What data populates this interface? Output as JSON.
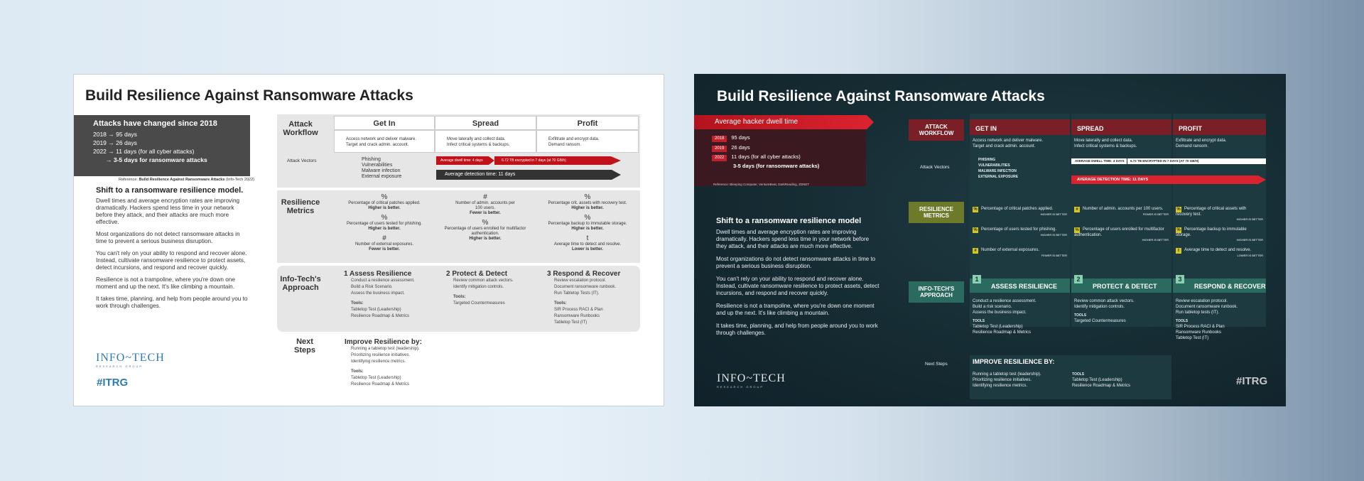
{
  "title": "Build Resilience Against Ransomware Attacks",
  "light": {
    "box_title": "Attacks have changed since 2018",
    "box_lines": [
      "2018 → 95 days",
      "2019 → 26 days",
      "2022 → 11 days (for all cyber attacks)"
    ],
    "box_strong": "→ 3-5 days for ransomware attacks",
    "reference_label": "Reference:",
    "reference_title": "Build Resilience Against Ransomware Attacks",
    "reference_source": "(Info-Tech 2022)",
    "body_heading": "Shift to a ransomware resilience model.",
    "paragraphs": [
      "Dwell times and average encryption rates are improving dramatically. Hackers spend less time in your network before they attack, and their attacks are much more effective.",
      "Most organizations do not detect ransomware attacks in time to prevent a serious business disruption.",
      "You can't rely on your ability to respond and recover alone. Instead, cultivate ransomware resilience to protect assets, detect incursions, and respond and recover quickly.",
      "Resilience is not a trampoline, where you're down one moment and up the next. It's like climbing a mountain.",
      "It takes time, planning, and help from people around you to work through challenges."
    ],
    "row_attack": "Attack Workflow",
    "row_vectors": "Attack Vectors",
    "row_metrics": "Resilience Metrics",
    "row_approach": "Info-Tech's Approach",
    "row_next": "Next Steps",
    "col_get_in": "Get In",
    "col_spread": "Spread",
    "col_profit": "Profit",
    "getin_items": [
      "Access network and deliver malware.",
      "Target and crack admin. account."
    ],
    "spread_items": [
      "Move laterally and collect data.",
      "Infect critical systems & backups."
    ],
    "profit_items": [
      "Exfiltrate and encrypt data.",
      "Demand ransom."
    ],
    "vectors": [
      "Phishing",
      "Vulnerabilities",
      "Malware infection",
      "External exposure"
    ],
    "dwell_bar": "Average dwell time: 4 days",
    "encrypt_bar": "6.72 TB encrypted in 7 days (at 70 GB/h)",
    "detection_bar": "Average detection time: 11 days",
    "m_pct": "%",
    "m_hash": "#",
    "m_t": "t",
    "m1": "Percentage of critical patches applied.",
    "m1b": "Higher is better.",
    "m2": "Percentage of users tested for phishing.",
    "m2b": "Higher is better.",
    "m3": "Number of external exposures.",
    "m3b": "Fewer is better.",
    "m4": "Number of admin. accounts per 100 users.",
    "m4b": "Fewer is better.",
    "m5": "Percentage of users enrolled for multifactor authentication.",
    "m5b": "Higher is better.",
    "m6": "Percentage crit. assets with recovery test.",
    "m6b": "Higher is better.",
    "m7": "Percentage backup to immutable storage.",
    "m7b": "Higher is better.",
    "m8": "Average time to detect and resolve.",
    "m8b": "Lower is better.",
    "s1_title": "1  Assess Resilience",
    "s1_items": [
      "Conduct a resilience assessment.",
      "Build a Risk Scenario.",
      "Assess the business impact."
    ],
    "s1_tools": "Tools:",
    "s1_tool1": "Tabletop Test (Leadership)",
    "s1_tool2": "Resilience Roadmap & Metrics",
    "s2_title": "2  Protect & Detect",
    "s2_items": [
      "Review common attack vectors.",
      "Identify mitigation controls."
    ],
    "s2_tools": "Tools:",
    "s2_tool1": "Targeted Countermeasures",
    "s3_title": "3  Respond & Recover",
    "s3_items": [
      "Review escalation protocol.",
      "Document ransomware runbook.",
      "Run Tabletop Tests (IT)."
    ],
    "s3_tools": "Tools:",
    "s3_tool1": "SIR Process RACI & Plan",
    "s3_tool2": "Ransomware Runbooks",
    "s3_tool3": "Tabletop Test (IT)",
    "next_title": "Improve Resilience by:",
    "next_items": [
      "Running a tabletop test (leadership).",
      "Prioritizing resilience initiatives.",
      "Identifying resilience metrics."
    ],
    "next_tools": "Tools:",
    "next_tool1": "Tabletop Test (Leadership)",
    "next_tool2": "Resilience Roadmap & Metrics",
    "logo_main": "INFO~TECH",
    "logo_sub": "RESEARCH GROUP",
    "logo_itrg": "#ITRG"
  },
  "dark": {
    "banner": "Average hacker dwell time",
    "years": [
      {
        "year": "2018",
        "text": "95 days"
      },
      {
        "year": "2019",
        "text": "26 days"
      },
      {
        "year": "2022",
        "text": "11 days (for all cyber attacks)"
      }
    ],
    "strong": "3-5 days (for ransomware attacks)",
    "reference": "Reference: Bleeping Computer, VentureBeat, DarkReading, ZDNET",
    "body_heading": "Shift to a ransomware resilience model",
    "paragraphs": [
      "Dwell times and average encryption rates are improving dramatically. Hackers spend less time in your network before they attack, and their attacks are much more effective.",
      "Most organizations do not detect ransomware attacks in time to prevent a serious business disruption.",
      "You can't rely on your ability to respond and recover alone. Instead, cultivate ransomware resilience to protect assets, detect incursions, and respond and recover quickly.",
      "Resilience is not a trampoline, where you're down one moment and up the next. It's like climbing a mountain.",
      "It takes time, planning, and help from people around you to work through challenges."
    ],
    "row_attack": "ATTACK WORKFLOW",
    "row_vectors": "Attack Vectors",
    "row_metrics": "RESILIENCE METRICS",
    "row_approach": "INFO-TECH'S APPROACH",
    "row_next": "Next Steps",
    "col_get_in": "GET IN",
    "col_spread": "SPREAD",
    "col_profit": "PROFIT",
    "getin_items": [
      "Access network and deliver malware.",
      "Target and crack admin. account."
    ],
    "spread_items": [
      "Move laterally and collect data.",
      "Infect critical systems & backups."
    ],
    "profit_items": [
      "Exfiltrate and encrypt data.",
      "Demand ransom."
    ],
    "vectors": [
      "PHISHING",
      "VULNERABILITIES",
      "MALWARE INFECTION",
      "EXTERNAL EXPOSURE"
    ],
    "dwell_bar": "AVERAGE DWELL TIME: 4 DAYS",
    "encrypt_bar": "6.72 TB ENCRYPTED IN 7 DAYS (AT 70 GB/H)",
    "detection_bar": "AVERAGE DETECTION TIME: 11 DAYS",
    "m_pct": "%",
    "m_hash": "#",
    "m_t": "t",
    "m1": "Percentage of critical patches applied.",
    "m1b": "HIGHER IS BETTER",
    "m2": "Percentage of users tested for phishing.",
    "m2b": "HIGHER IS BETTER",
    "m3": "Number of external exposures.",
    "m3b": "FEWER IS BETTER",
    "m4": "Number of admin. accounts per 100 users.",
    "m4b": "FEWER IS BETTER",
    "m5": "Percentage of users enrolled for multifactor authentication.",
    "m5b": "HIGHER IS BETTER",
    "m6": "Percentage of critical assets with recovery test.",
    "m6b": "HIGHER IS BETTER",
    "m7": "Percentage backup to immutable storage.",
    "m7b": "HIGHER IS BETTER",
    "m8": "Average time to detect and resolve.",
    "m8b": "LOWER IS BETTER",
    "n1": "1",
    "n2": "2",
    "n3": "3",
    "s1_title": "ASSESS RESILIENCE",
    "s1_items": [
      "Conduct a resilience assessment.",
      "Build a risk scenario.",
      "Assess the business impact."
    ],
    "s1_tools": "TOOLS",
    "s1_tool1": "Tabletop Test (Leadership)",
    "s1_tool2": "Resilience Roadmap & Metrics",
    "s2_title": "PROTECT & DETECT",
    "s2_items": [
      "Review common attack vectors.",
      "Identify mitigation controls."
    ],
    "s2_tools": "TOOLS",
    "s2_tool1": "Targeted Countermeasures",
    "s3_title": "RESPOND & RECOVER",
    "s3_items": [
      "Review escalation protocol.",
      "Document ransomware runbook.",
      "Run tabletop tests (IT)."
    ],
    "s3_tools": "TOOLS",
    "s3_tool1": "SIR Process RACI & Plan",
    "s3_tool2": "Ransomware Runbooks",
    "s3_tool3": "Tabletop Test (IT)",
    "next_title": "IMPROVE RESILIENCE BY:",
    "next_items": [
      "Running a tabletop test (leadership).",
      "Prioritizing resilience initiatives.",
      "Identifying resilience metrics."
    ],
    "next_tools": "TOOLS",
    "next_tool1": "Tabletop Test (Leadership)",
    "next_tool2": "Resilience Roadmap & Metrics",
    "logo_main": "INFO~TECH",
    "logo_sub": "RESEARCH GROUP",
    "logo_itrg": "#ITRG"
  },
  "colors": {
    "red": "#d9232f",
    "dark_bg": "#152a31",
    "olive": "#6d7a2a",
    "teal": "#2a6a5f",
    "info_tech_blue": "#2b7bb8"
  }
}
